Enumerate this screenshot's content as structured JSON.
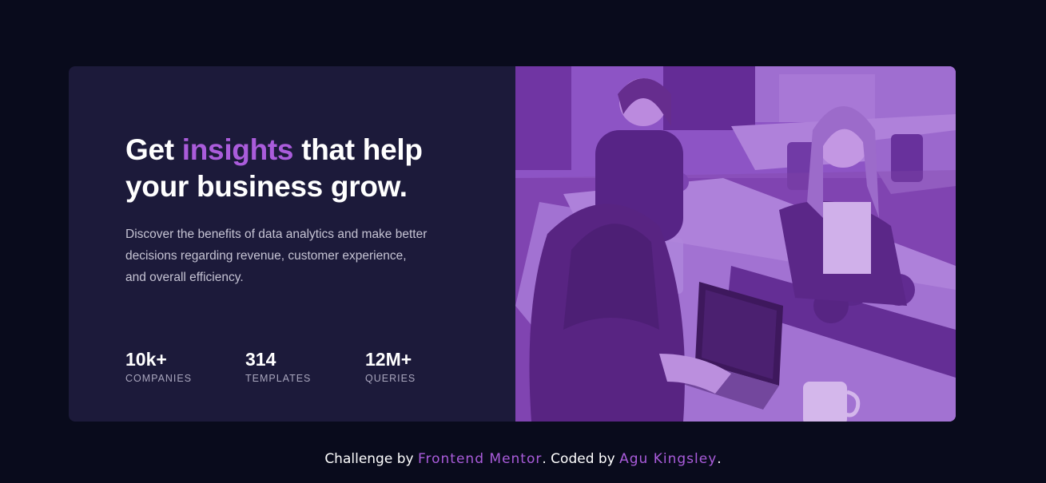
{
  "card": {
    "headline_part1": "Get ",
    "headline_accent": "insights",
    "headline_part2": " that help your business grow.",
    "description": "Discover the benefits of data analytics and make better decisions regarding revenue, customer experience, and overall efficiency.",
    "stats": [
      {
        "value": "10k+",
        "label": "COMPANIES"
      },
      {
        "value": "314",
        "label": "TEMPLATES"
      },
      {
        "value": "12M+",
        "label": "QUERIES"
      }
    ],
    "image_subject": "office-workers-photo"
  },
  "footer": {
    "prefix": "Challenge by ",
    "challenge_link": "Frontend Mentor",
    "middle": ". Coded by ",
    "author_link": "Agu Kingsley",
    "suffix": "."
  },
  "colors": {
    "page_background": "#090b1c",
    "card_background": "#1c1a3a",
    "accent": "#aa5cdb",
    "image_tint": "#7b3fae"
  }
}
